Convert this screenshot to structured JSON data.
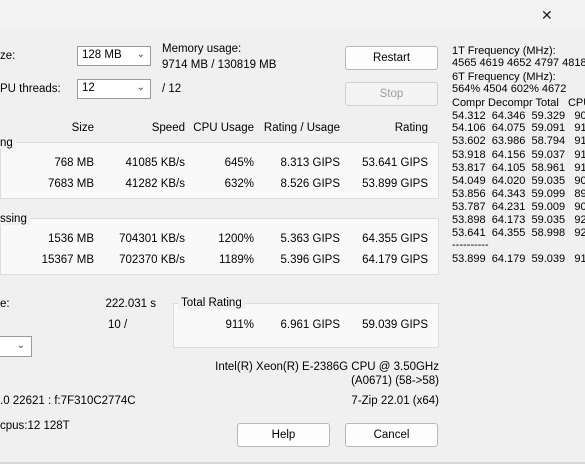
{
  "window": {
    "close_glyph": "✕"
  },
  "settings": {
    "dict_size_label": "ze:",
    "dict_size_value": "128 MB",
    "threads_label": "PU threads:",
    "threads_value": "12",
    "threads_total": "/ 12",
    "memory_label": "Memory usage:",
    "memory_value": "9714 MB / 130819 MB"
  },
  "buttons": {
    "restart": "Restart",
    "stop": "Stop",
    "help": "Help",
    "cancel": "Cancel"
  },
  "table": {
    "headers": {
      "size": "Size",
      "speed": "Speed",
      "cpu": "CPU Usage",
      "rating_usage": "Rating / Usage",
      "rating": "Rating"
    },
    "compress_label": "ng",
    "compress_rows": [
      {
        "size": "768 MB",
        "speed": "41085 KB/s",
        "cpu": "645%",
        "ru": "8.313 GIPS",
        "rating": "53.641 GIPS"
      },
      {
        "size": "7683 MB",
        "speed": "41282 KB/s",
        "cpu": "632%",
        "ru": "8.526 GIPS",
        "rating": "53.899 GIPS"
      }
    ],
    "decompress_label": "ssing",
    "decompress_rows": [
      {
        "size": "1536 MB",
        "speed": "704301 KB/s",
        "cpu": "1200%",
        "ru": "5.363 GIPS",
        "rating": "64.355 GIPS"
      },
      {
        "size": "15367 MB",
        "speed": "702370 KB/s",
        "cpu": "1189%",
        "ru": "5.396 GIPS",
        "rating": "64.179 GIPS"
      }
    ]
  },
  "summary": {
    "elapsed_label": "e:",
    "elapsed_value": "222.031 s",
    "passes_value": "10 /",
    "total_label": "Total Rating",
    "total_cpu": "911%",
    "total_ru": "6.961 GIPS",
    "total_rating": "59.039 GIPS"
  },
  "system": {
    "cpu_name": "Intel(R) Xeon(R) E-2386G CPU @ 3.50GHz",
    "cpu_id": "(A0671) (58->58)",
    "os": ".0 22621 : f:7F310C2774C",
    "version": "7-Zip 22.01 (x64)",
    "cpus": "cpus:12 128T"
  },
  "right": {
    "freq1_label": "1T Frequency (MHz):",
    "freq1_values": " 4565 4619 4652 4797 4818",
    "freq6_label": "6T Frequency (MHz):",
    "freq6_values": " 564% 4504 602% 4672",
    "cols_header": "Compr Decompr Total   CPU",
    "rows": [
      "54.312  64.346  59.329   90",
      "54.106  64.075  59.091   91",
      "53.602  63.986  58.794   91",
      "53.918  64.156  59.037   91",
      "53.817  64.105  58.961   91",
      "54.049  64.020  59.035   90",
      "53.856  64.343  59.099   89",
      "53.787  64.231  59.009   90",
      "53.898  64.173  59.035   92",
      "53.641  64.355  58.998   92"
    ],
    "separator": "----------",
    "total_row": "53.899  64.179  59.039   91"
  }
}
